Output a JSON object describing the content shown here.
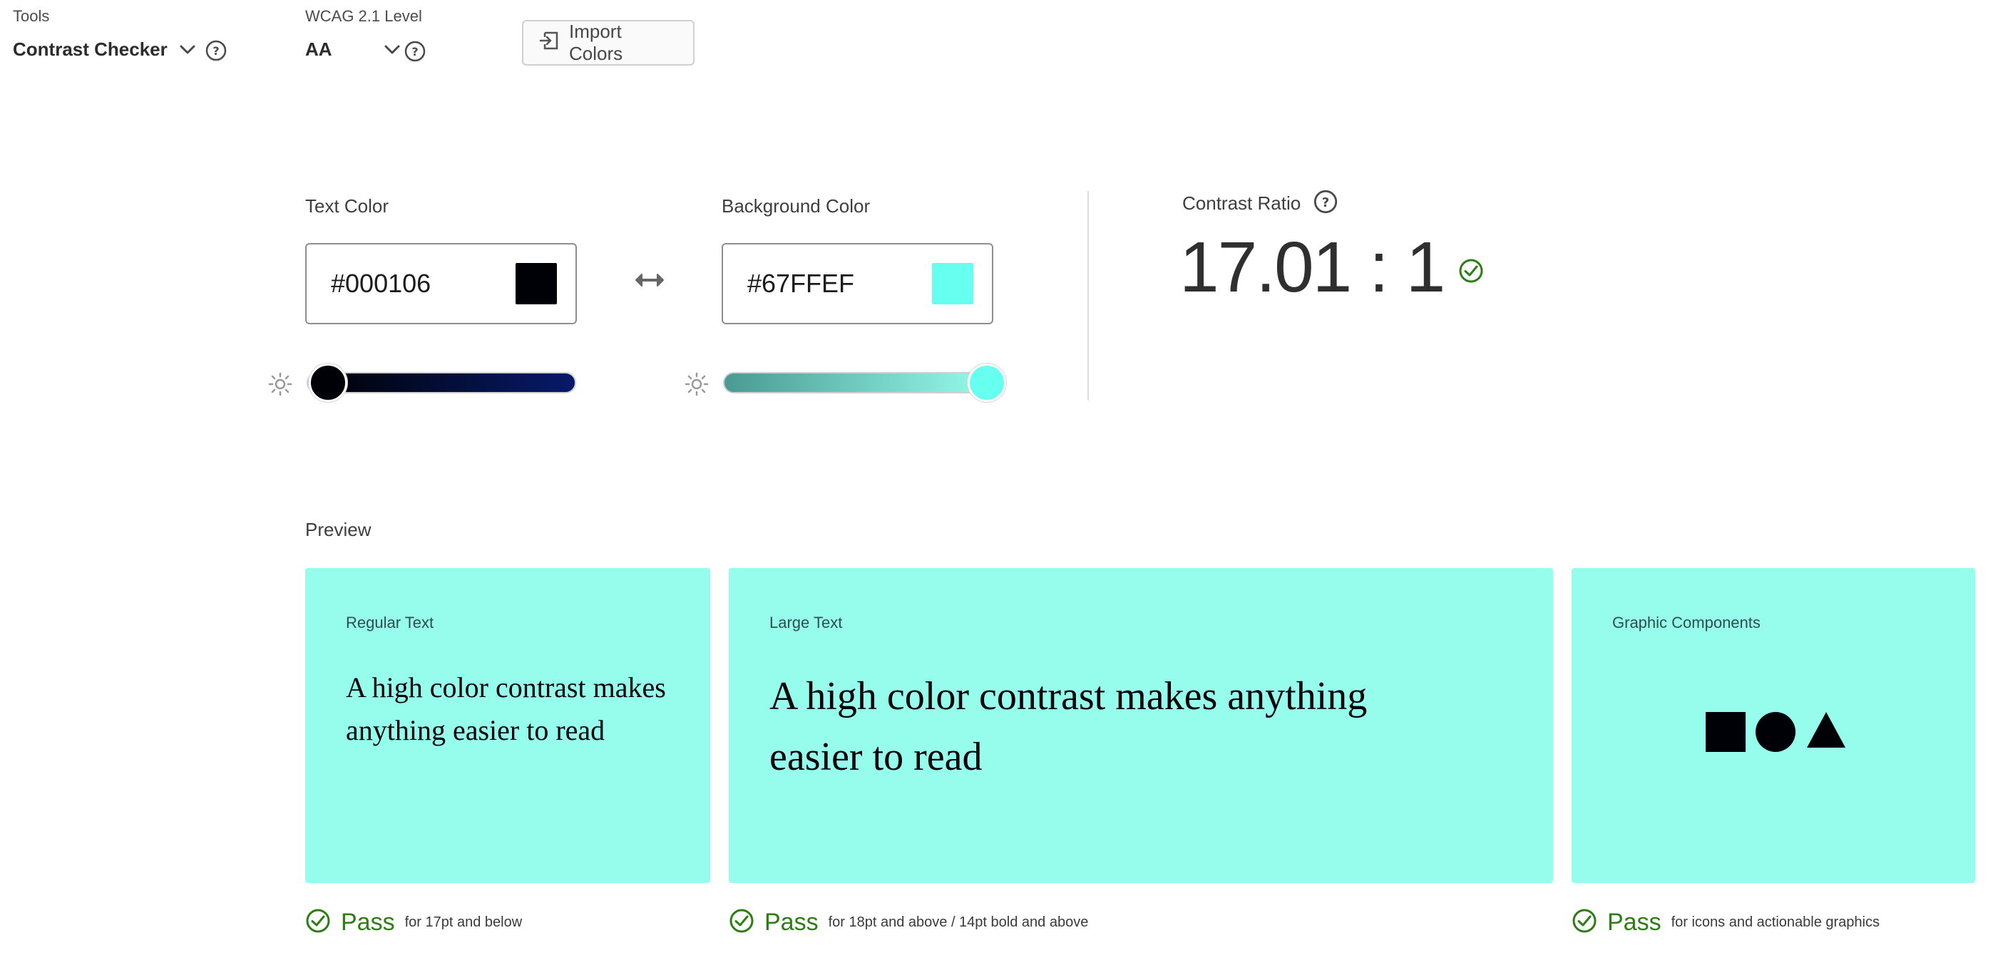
{
  "toolbar": {
    "tools_label": "Tools",
    "tools_value": "Contrast Checker",
    "wcag_label": "WCAG 2.1 Level",
    "wcag_value": "AA",
    "import_label": "Import Colors"
  },
  "text_color": {
    "label": "Text Color",
    "hex": "#000106",
    "brightness_level": 0.08
  },
  "background_color": {
    "label": "Background Color",
    "hex": "#67FFEF",
    "brightness_level": 0.98
  },
  "contrast": {
    "label": "Contrast Ratio",
    "value": "17.01 : 1"
  },
  "preview": {
    "label": "Preview",
    "regular": {
      "title": "Regular Text",
      "text": "A high color contrast makes anything easier to read",
      "result": "Pass",
      "note": "for 17pt and below"
    },
    "large": {
      "title": "Large Text",
      "text": "A high color contrast makes anything easier to read",
      "result": "Pass",
      "note": "for 18pt and above / 14pt bold and above"
    },
    "graphic": {
      "title": "Graphic Components",
      "result": "Pass",
      "note": "for icons and actionable graphics"
    }
  },
  "colors": {
    "pass_green": "#2d7d15",
    "preview_bg": "#96FCEC",
    "accent_teal": "#67FFEF"
  },
  "icons": [
    "chevron-down-icon",
    "help-icon",
    "import-icon",
    "swap-icon",
    "brightness-icon",
    "check-circle-icon"
  ]
}
